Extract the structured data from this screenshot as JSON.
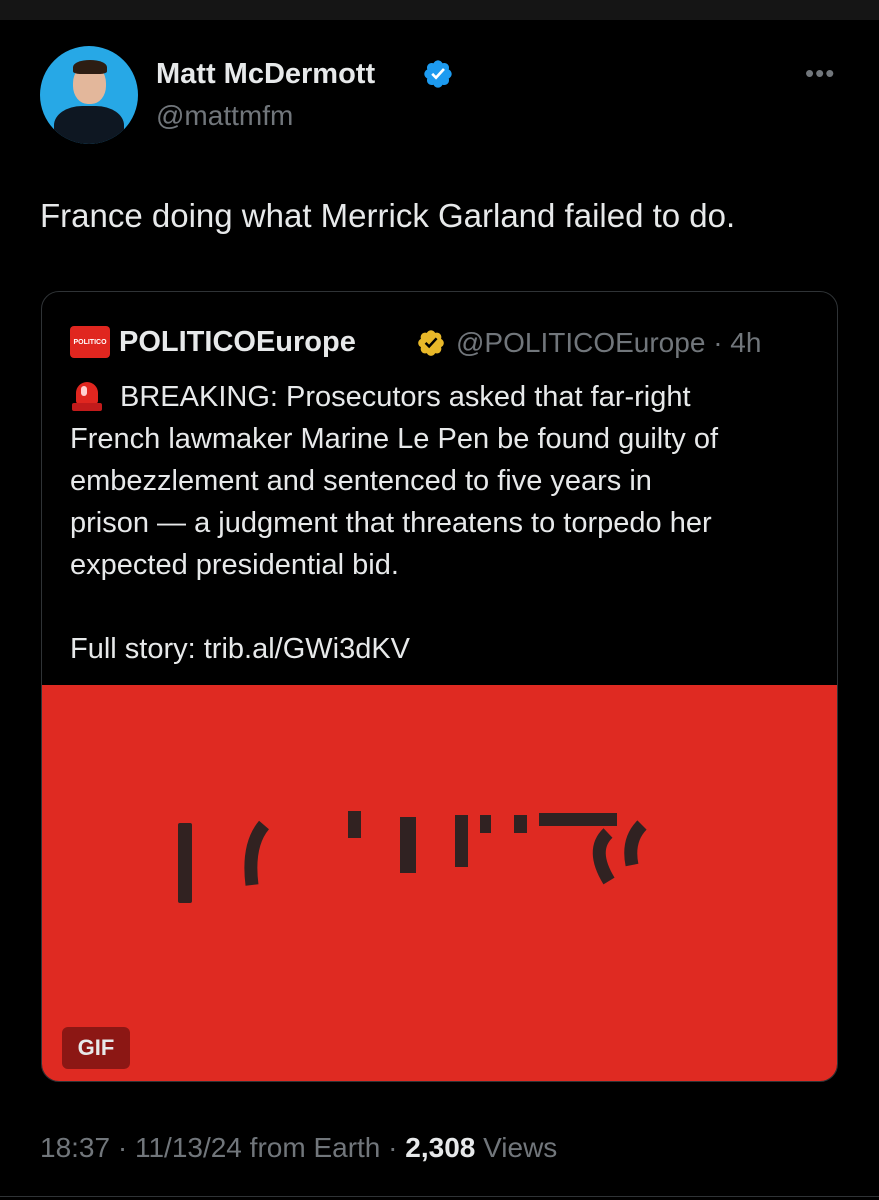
{
  "author": {
    "name": "Matt McDermott",
    "handle": "@mattmfm",
    "verified_color": "#1d9bf0"
  },
  "more_icon": "more-horizontal-icon",
  "tweet": {
    "text": "France doing what Merrick Garland failed to do."
  },
  "quote": {
    "logo_text": "POLITICO",
    "name": "POLITICOEurope",
    "badge_color": "#e8b829",
    "handle": "@POLITICOEurope",
    "time": "4h",
    "siren_icon": "police-siren-icon",
    "lines": [
      "BREAKING: Prosecutors asked that far-right",
      "French lawmaker Marine Le Pen be found guilty of",
      "embezzlement and sentenced to five years in",
      "prison — a judgment that threatens to torpedo her",
      "expected presidential bid."
    ],
    "full_story": "Full story: trib.al/GWi3dKV",
    "media_badge": "GIF",
    "media_color": "#df2a22"
  },
  "footer": {
    "time": "18:37",
    "date": "11/13/24",
    "source": "from Earth",
    "views_count": "2,308",
    "views_label": "Views"
  }
}
